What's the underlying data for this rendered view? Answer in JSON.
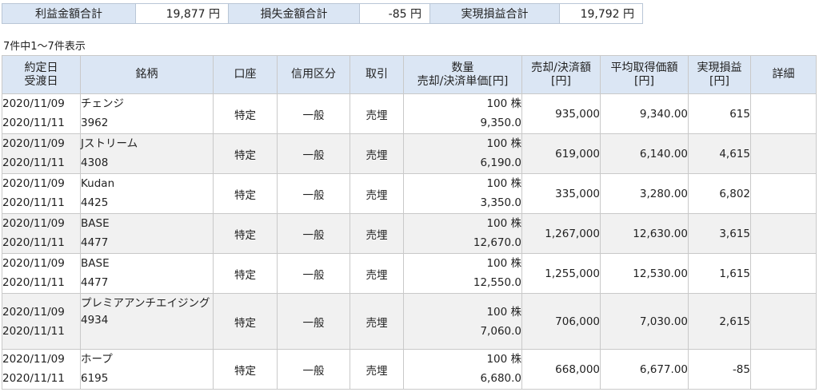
{
  "summary": {
    "profit_label": "利益金額合計",
    "profit_value": "19,877 円",
    "loss_label": "損失金額合計",
    "loss_value": "-85 円",
    "realized_label": "実現損益合計",
    "realized_value": "19,792 円"
  },
  "count_text": "7件中1～7件表示",
  "headers": {
    "date_top": "約定日",
    "date_bottom": "受渡日",
    "name": "銘柄",
    "account": "口座",
    "margin": "信用区分",
    "trade": "取引",
    "qty_top": "数量",
    "qty_bottom": "売却/決済単価[円]",
    "sale_top": "売却/決済額",
    "sale_bottom": "[円]",
    "avg_top": "平均取得価額",
    "avg_bottom": "[円]",
    "pl_top": "実現損益",
    "pl_bottom": "[円]",
    "detail": "詳細"
  },
  "rows": [
    {
      "trade_date": "2020/11/09",
      "settle_date": "2020/11/11",
      "name": "チェンジ",
      "code": "3962",
      "account": "特定",
      "margin": "一般",
      "trade": "売埋",
      "qty": "100 株",
      "price": "9,350.0",
      "amount": "935,000",
      "avg_cost": "9,340.00",
      "pl": "615"
    },
    {
      "trade_date": "2020/11/09",
      "settle_date": "2020/11/11",
      "name": "Jストリーム",
      "code": "4308",
      "account": "特定",
      "margin": "一般",
      "trade": "売埋",
      "qty": "100 株",
      "price": "6,190.0",
      "amount": "619,000",
      "avg_cost": "6,140.00",
      "pl": "4,615"
    },
    {
      "trade_date": "2020/11/09",
      "settle_date": "2020/11/11",
      "name": "Kudan",
      "code": "4425",
      "account": "特定",
      "margin": "一般",
      "trade": "売埋",
      "qty": "100 株",
      "price": "3,350.0",
      "amount": "335,000",
      "avg_cost": "3,280.00",
      "pl": "6,802"
    },
    {
      "trade_date": "2020/11/09",
      "settle_date": "2020/11/11",
      "name": "BASE",
      "code": "4477",
      "account": "特定",
      "margin": "一般",
      "trade": "売埋",
      "qty": "100 株",
      "price": "12,670.0",
      "amount": "1,267,000",
      "avg_cost": "12,630.00",
      "pl": "3,615"
    },
    {
      "trade_date": "2020/11/09",
      "settle_date": "2020/11/11",
      "name": "BASE",
      "code": "4477",
      "account": "特定",
      "margin": "一般",
      "trade": "売埋",
      "qty": "100 株",
      "price": "12,550.0",
      "amount": "1,255,000",
      "avg_cost": "12,530.00",
      "pl": "1,615"
    },
    {
      "trade_date": "2020/11/09",
      "settle_date": "2020/11/11",
      "name": "プレミアアンチエイジング",
      "code": "4934",
      "account": "特定",
      "margin": "一般",
      "trade": "売埋",
      "qty": "100 株",
      "price": "7,060.0",
      "amount": "706,000",
      "avg_cost": "7,030.00",
      "pl": "2,615"
    },
    {
      "trade_date": "2020/11/09",
      "settle_date": "2020/11/11",
      "name": "ホープ",
      "code": "6195",
      "account": "特定",
      "margin": "一般",
      "trade": "売埋",
      "qty": "100 株",
      "price": "6,680.0",
      "amount": "668,000",
      "avg_cost": "6,677.00",
      "pl": "-85"
    }
  ]
}
